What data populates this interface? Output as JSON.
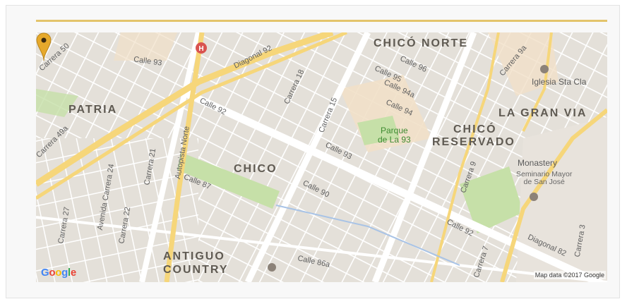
{
  "map": {
    "neighborhoods": [
      "CHICÓ NORTE",
      "PATRIA",
      "LA GRAN VIA",
      "CHICÓ",
      "RESERVADO",
      "CHICO",
      "ANTIGUO",
      "COUNTRY"
    ],
    "streets": {
      "carrera_50": "Carrera 50",
      "calle_93_w": "Calle 93",
      "diagonal_92": "Diagonal 92",
      "carrera_18": "Carrera 18",
      "calle_96": "Calle 96",
      "calle_95": "Calle 95",
      "calle_94a": "Calle 94a",
      "calle_94": "Calle 94",
      "carrera_9a": "Carrera 9a",
      "carrera_49a": "Carrera 49a",
      "calle_92": "Calle 92",
      "carrera_15": "Carrera 15",
      "calle_93": "Calle 93",
      "autopista_norte": "Autopista Norte",
      "carrera_24": "Avenida Carrera 24",
      "carrera_21": "Carrera 21",
      "calle_87": "Calle 87",
      "carrera_9": "Carrera 9",
      "calle_90": "Calle 90",
      "carrera_27": "Carrera 27",
      "carrera_22": "Carrera 22",
      "calle_92_e": "Calle 92",
      "carrera_7": "Carrera 7",
      "diagonal_82": "Diagonal 82",
      "calle_86a": "Calle 86a",
      "carrera_3": "Carrera 3"
    },
    "park": [
      "Parque",
      "de La 93"
    ],
    "pois": {
      "iglesia": "Iglesia Sta Cla",
      "monastery": "Monastery",
      "seminario_1": "Seminario Mayor",
      "seminario_2": "de San José"
    },
    "logo": "Google",
    "attribution": "Map data ©2017 Google",
    "colors": {
      "accent": "#e3c46b",
      "pin": "#e6a92c",
      "park": "#c6e0a8",
      "block": "#e2ded6",
      "street": "#ffffff",
      "highway": "#f6d67a"
    }
  }
}
